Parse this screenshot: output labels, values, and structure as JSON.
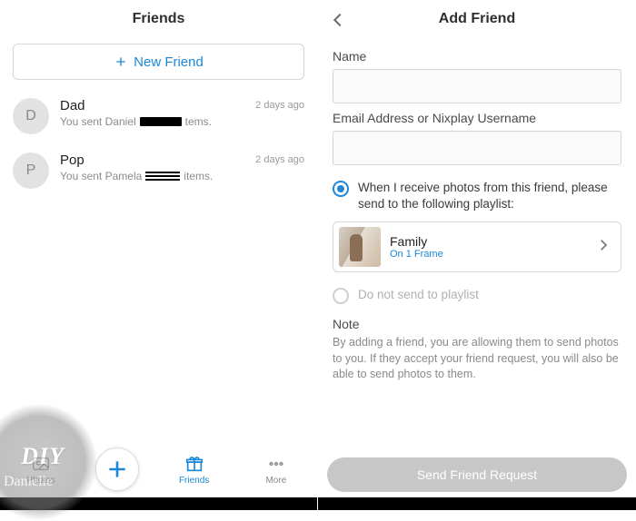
{
  "left": {
    "title": "Friends",
    "new_friend_label": "New Friend",
    "friends": [
      {
        "initial": "D",
        "name": "Dad",
        "sub_prefix": "You sent Daniel",
        "sub_suffix": "tems.",
        "time": "2 days ago"
      },
      {
        "initial": "P",
        "name": "Pop",
        "sub_prefix": "You sent Pamela",
        "sub_suffix": "items.",
        "time": "2 days ago"
      }
    ],
    "tabs": {
      "photos": "Photos",
      "friends": "Friends",
      "more": "More"
    }
  },
  "right": {
    "title": "Add Friend",
    "name_label": "Name",
    "email_label": "Email Address or Nixplay Username",
    "opt_playlist": "When I receive photos from this friend, please send to the following playlist:",
    "playlist_name": "Family",
    "playlist_sub": "On 1 Frame",
    "opt_noplaylist": "Do not send to playlist",
    "note_head": "Note",
    "note_body": "By adding a friend, you are allowing them to send photos to you. If they accept your friend request, you will also be able to send photos to them.",
    "send_label": "Send Friend Request"
  },
  "watermark": {
    "main": "DIY",
    "sub": "Danielle"
  }
}
